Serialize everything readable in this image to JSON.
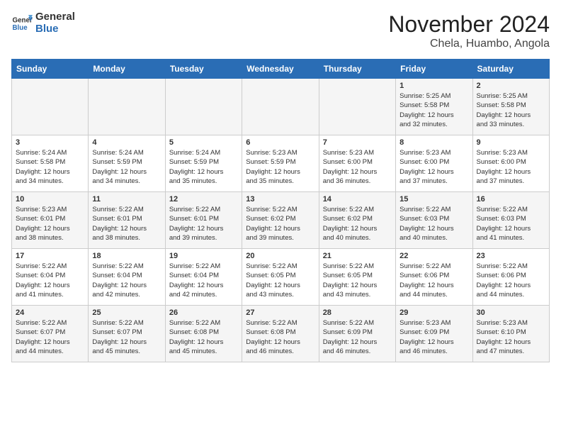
{
  "header": {
    "logo_general": "General",
    "logo_blue": "Blue",
    "month_title": "November 2024",
    "location": "Chela, Huambo, Angola"
  },
  "calendar": {
    "days_of_week": [
      "Sunday",
      "Monday",
      "Tuesday",
      "Wednesday",
      "Thursday",
      "Friday",
      "Saturday"
    ],
    "weeks": [
      [
        {
          "day": "",
          "info": ""
        },
        {
          "day": "",
          "info": ""
        },
        {
          "day": "",
          "info": ""
        },
        {
          "day": "",
          "info": ""
        },
        {
          "day": "",
          "info": ""
        },
        {
          "day": "1",
          "info": "Sunrise: 5:25 AM\nSunset: 5:58 PM\nDaylight: 12 hours\nand 32 minutes."
        },
        {
          "day": "2",
          "info": "Sunrise: 5:25 AM\nSunset: 5:58 PM\nDaylight: 12 hours\nand 33 minutes."
        }
      ],
      [
        {
          "day": "3",
          "info": "Sunrise: 5:24 AM\nSunset: 5:58 PM\nDaylight: 12 hours\nand 34 minutes."
        },
        {
          "day": "4",
          "info": "Sunrise: 5:24 AM\nSunset: 5:59 PM\nDaylight: 12 hours\nand 34 minutes."
        },
        {
          "day": "5",
          "info": "Sunrise: 5:24 AM\nSunset: 5:59 PM\nDaylight: 12 hours\nand 35 minutes."
        },
        {
          "day": "6",
          "info": "Sunrise: 5:23 AM\nSunset: 5:59 PM\nDaylight: 12 hours\nand 35 minutes."
        },
        {
          "day": "7",
          "info": "Sunrise: 5:23 AM\nSunset: 6:00 PM\nDaylight: 12 hours\nand 36 minutes."
        },
        {
          "day": "8",
          "info": "Sunrise: 5:23 AM\nSunset: 6:00 PM\nDaylight: 12 hours\nand 37 minutes."
        },
        {
          "day": "9",
          "info": "Sunrise: 5:23 AM\nSunset: 6:00 PM\nDaylight: 12 hours\nand 37 minutes."
        }
      ],
      [
        {
          "day": "10",
          "info": "Sunrise: 5:23 AM\nSunset: 6:01 PM\nDaylight: 12 hours\nand 38 minutes."
        },
        {
          "day": "11",
          "info": "Sunrise: 5:22 AM\nSunset: 6:01 PM\nDaylight: 12 hours\nand 38 minutes."
        },
        {
          "day": "12",
          "info": "Sunrise: 5:22 AM\nSunset: 6:01 PM\nDaylight: 12 hours\nand 39 minutes."
        },
        {
          "day": "13",
          "info": "Sunrise: 5:22 AM\nSunset: 6:02 PM\nDaylight: 12 hours\nand 39 minutes."
        },
        {
          "day": "14",
          "info": "Sunrise: 5:22 AM\nSunset: 6:02 PM\nDaylight: 12 hours\nand 40 minutes."
        },
        {
          "day": "15",
          "info": "Sunrise: 5:22 AM\nSunset: 6:03 PM\nDaylight: 12 hours\nand 40 minutes."
        },
        {
          "day": "16",
          "info": "Sunrise: 5:22 AM\nSunset: 6:03 PM\nDaylight: 12 hours\nand 41 minutes."
        }
      ],
      [
        {
          "day": "17",
          "info": "Sunrise: 5:22 AM\nSunset: 6:04 PM\nDaylight: 12 hours\nand 41 minutes."
        },
        {
          "day": "18",
          "info": "Sunrise: 5:22 AM\nSunset: 6:04 PM\nDaylight: 12 hours\nand 42 minutes."
        },
        {
          "day": "19",
          "info": "Sunrise: 5:22 AM\nSunset: 6:04 PM\nDaylight: 12 hours\nand 42 minutes."
        },
        {
          "day": "20",
          "info": "Sunrise: 5:22 AM\nSunset: 6:05 PM\nDaylight: 12 hours\nand 43 minutes."
        },
        {
          "day": "21",
          "info": "Sunrise: 5:22 AM\nSunset: 6:05 PM\nDaylight: 12 hours\nand 43 minutes."
        },
        {
          "day": "22",
          "info": "Sunrise: 5:22 AM\nSunset: 6:06 PM\nDaylight: 12 hours\nand 44 minutes."
        },
        {
          "day": "23",
          "info": "Sunrise: 5:22 AM\nSunset: 6:06 PM\nDaylight: 12 hours\nand 44 minutes."
        }
      ],
      [
        {
          "day": "24",
          "info": "Sunrise: 5:22 AM\nSunset: 6:07 PM\nDaylight: 12 hours\nand 44 minutes."
        },
        {
          "day": "25",
          "info": "Sunrise: 5:22 AM\nSunset: 6:07 PM\nDaylight: 12 hours\nand 45 minutes."
        },
        {
          "day": "26",
          "info": "Sunrise: 5:22 AM\nSunset: 6:08 PM\nDaylight: 12 hours\nand 45 minutes."
        },
        {
          "day": "27",
          "info": "Sunrise: 5:22 AM\nSunset: 6:08 PM\nDaylight: 12 hours\nand 46 minutes."
        },
        {
          "day": "28",
          "info": "Sunrise: 5:22 AM\nSunset: 6:09 PM\nDaylight: 12 hours\nand 46 minutes."
        },
        {
          "day": "29",
          "info": "Sunrise: 5:23 AM\nSunset: 6:09 PM\nDaylight: 12 hours\nand 46 minutes."
        },
        {
          "day": "30",
          "info": "Sunrise: 5:23 AM\nSunset: 6:10 PM\nDaylight: 12 hours\nand 47 minutes."
        }
      ]
    ]
  }
}
